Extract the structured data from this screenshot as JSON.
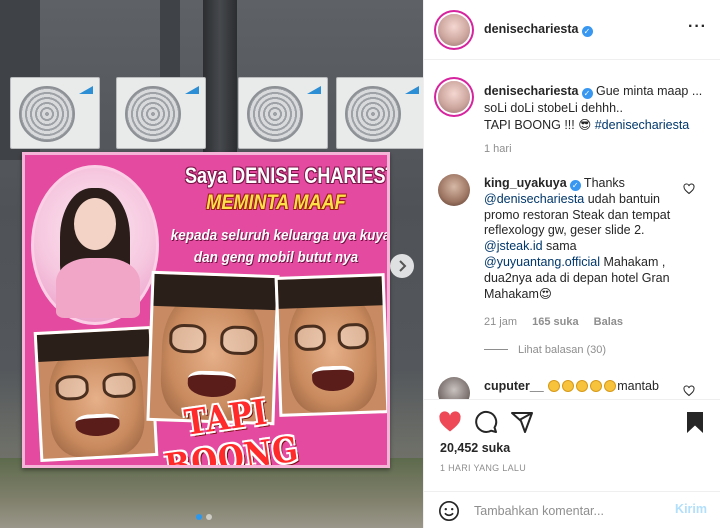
{
  "post_image": {
    "banner_lines": [
      "Saya DENISE CHARIESTA",
      "MEMINTA MAAF",
      "kepada seluruh keluarga uya kuya",
      "dan geng mobil butut nya"
    ],
    "banner_stamp": "TAPI BOONG",
    "next_icon": "chevron-right-icon",
    "carousel": {
      "count": 2,
      "active": 0
    }
  },
  "header": {
    "username": "denisechariesta",
    "verified": true,
    "more_icon": "more-horizontal-icon",
    "more_label": "···"
  },
  "caption": {
    "username": "denisechariesta",
    "text_line1": " Gue minta maap ...",
    "text_line2": "soLi doLi stobeLi dehhh..",
    "text_line3": "TAPI BOONG !!! 😎 ",
    "hashtag": "#denisechariesta",
    "time": "1 hari"
  },
  "comments": [
    {
      "username": "king_uyakuya",
      "verified": true,
      "text_a": " Thanks",
      "mention1": "@denisechariesta",
      "text_b": " udah bantuin promo restoran Steak dan tempat reflexology gw, geser slide 2.",
      "mention2": "@jsteak.id",
      "text_c": " sama",
      "mention3": "@yuyuantang.official",
      "text_d": " Mahakam , dua2nya ada di depan hotel Gran Mahakam😍",
      "time": "21 jam",
      "likes": "165 suka",
      "reply": "Balas",
      "view_replies": "Lihat balasan (30)"
    },
    {
      "username": "cuputer__",
      "text": "mantab"
    }
  ],
  "actions": {
    "likes": "20,452 suka",
    "time_ago": "1 HARI YANG LALU",
    "icons": [
      "heart-filled-icon",
      "comment-icon",
      "share-icon",
      "bookmark-icon"
    ]
  },
  "add_comment": {
    "placeholder": "Tambahkan komentar...",
    "post_label": "Kirim",
    "emoji_icon": "emoji-icon"
  },
  "colors": {
    "like_red": "#ed4956",
    "verified_blue": "#3897f0",
    "link_blue": "#00376b",
    "muted_gray": "#8e8e8e",
    "post_disabled": "#b2dffc",
    "banner_pink": "#e44aa0"
  }
}
